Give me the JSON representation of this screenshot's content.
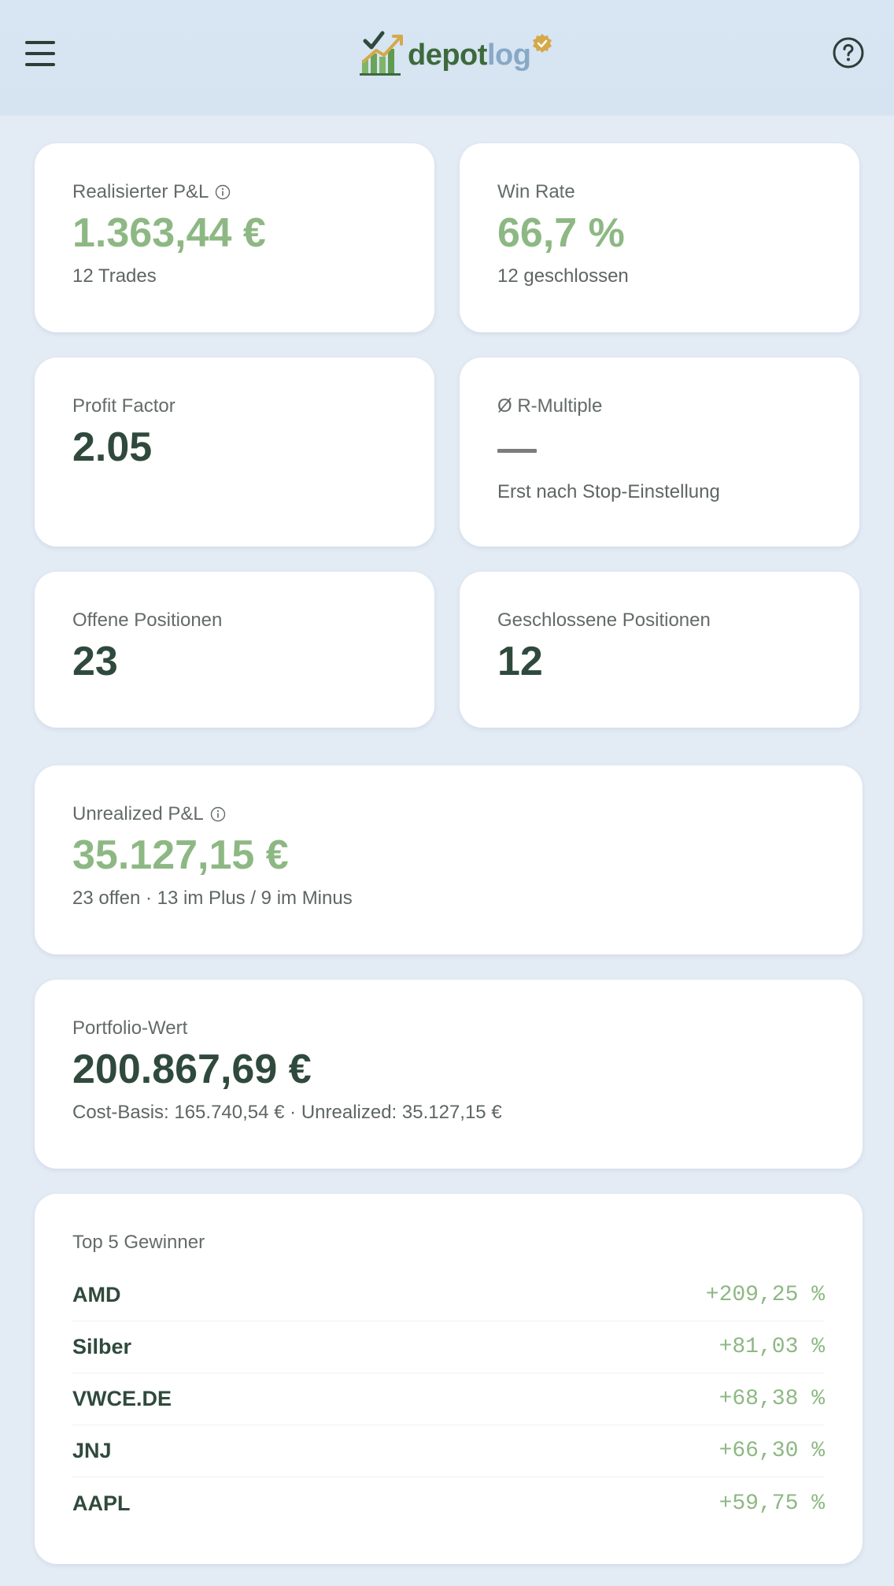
{
  "header": {
    "logo_text_depot": "depot",
    "logo_text_log": "log",
    "menu_icon": "hamburger-menu-icon",
    "help_icon": "help-circle-icon"
  },
  "colors": {
    "positive": "#8db883",
    "primary_text": "#2f4a3c",
    "background": "#e3ebf5",
    "header_bg": "#d8e5f3",
    "logo_green": "#3d6a3c",
    "logo_blue": "#86a9c6",
    "badge_gold": "#d4a94a"
  },
  "cards": {
    "realized_pnl": {
      "label": "Realisierter P&L",
      "value": "1.363,44 €",
      "sub": "12 Trades"
    },
    "win_rate": {
      "label": "Win Rate",
      "value": "66,7 %",
      "sub": "12 geschlossen"
    },
    "profit_factor": {
      "label": "Profit Factor",
      "value": "2.05"
    },
    "r_multiple": {
      "label": "Ø R-Multiple",
      "sub": "Erst nach Stop-Einstellung"
    },
    "open_positions": {
      "label": "Offene Positionen",
      "value": "23"
    },
    "closed_positions": {
      "label": "Geschlossene Positionen",
      "value": "12"
    },
    "unrealized_pnl": {
      "label": "Unrealized P&L",
      "value": "35.127,15 €",
      "sub": "23 offen · 13 im Plus / 9 im Minus"
    },
    "portfolio_value": {
      "label": "Portfolio-Wert",
      "value": "200.867,69 €",
      "sub": "Cost-Basis: 165.740,54 € · Unrealized: 35.127,15 €"
    }
  },
  "top_winners": {
    "title": "Top 5 Gewinner",
    "items": [
      {
        "symbol": "AMD",
        "change": "+209,25 %"
      },
      {
        "symbol": "Silber",
        "change": "+81,03 %"
      },
      {
        "symbol": "VWCE.DE",
        "change": "+68,38 %"
      },
      {
        "symbol": "JNJ",
        "change": "+66,30 %"
      },
      {
        "symbol": "AAPL",
        "change": "+59,75 %"
      }
    ]
  }
}
